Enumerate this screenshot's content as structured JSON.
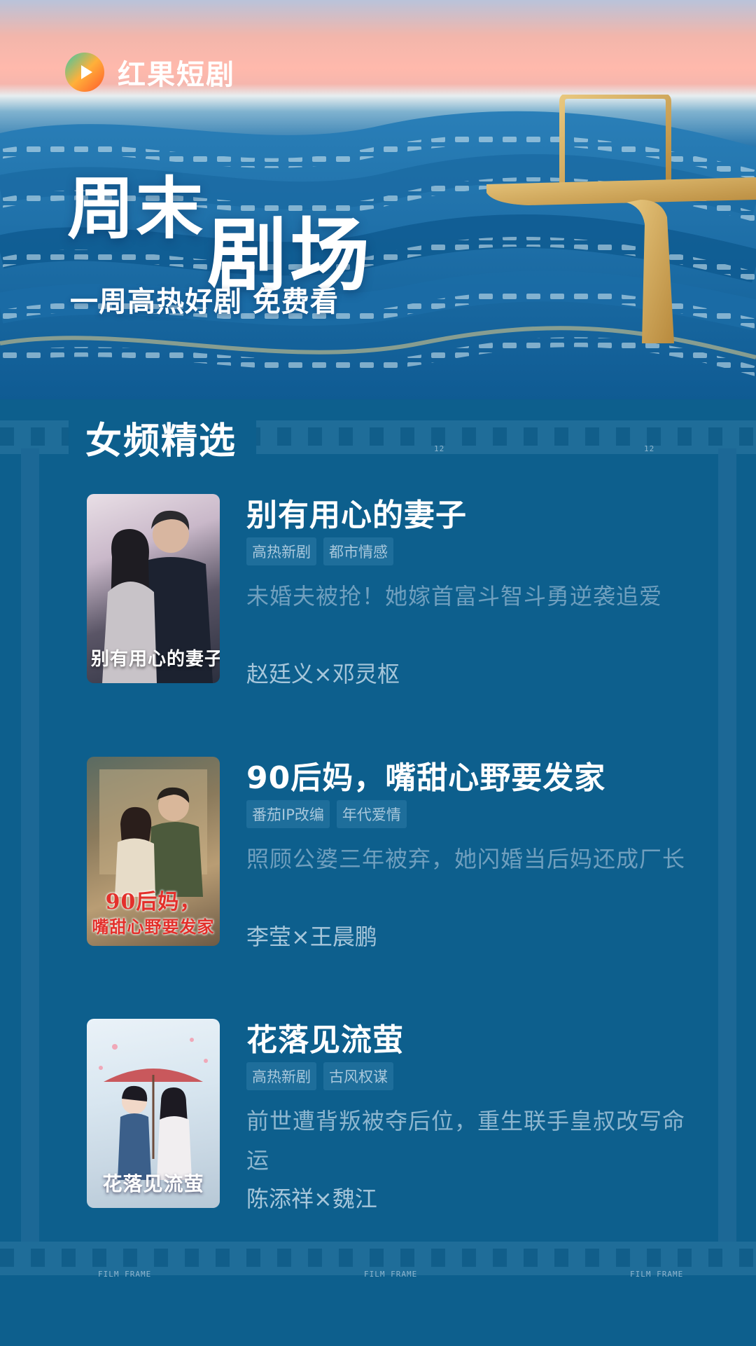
{
  "header": {
    "app_name": "红果短剧",
    "title_part1": "周末",
    "title_part2": "剧场",
    "subtitle": "一周高热好剧 免费看"
  },
  "section": {
    "title": "女频精选"
  },
  "film_labels": {
    "num_12": "12",
    "film_frame": "FILM FRAME"
  },
  "dramas": [
    {
      "title": "别有用心的妻子",
      "tags": [
        "高热新剧",
        "都市情感"
      ],
      "description": "未婚夫被抢！她嫁首富斗智斗勇逆袭追爱",
      "cast": "赵廷义×邓灵枢",
      "poster_text": "别有用心的妻子"
    },
    {
      "title": "90后妈，嘴甜心野要发家",
      "tags": [
        "番茄IP改编",
        "年代爱情"
      ],
      "description": "照顾公婆三年被弃，她闪婚当后妈还成厂长",
      "cast": "李莹×王晨鹏",
      "poster_text_line1": "90后妈，",
      "poster_text_line2": "嘴甜心野要发家"
    },
    {
      "title": "花落见流萤",
      "tags": [
        "高热新剧",
        "古风权谋"
      ],
      "description": "前世遭背叛被夺后位，重生联手皇叔改写命运",
      "cast": "陈添祥×魏江",
      "poster_text": "花落见流萤"
    }
  ],
  "colors": {
    "background": "#0d5f8d",
    "tag_bg": "#1e6e9b",
    "desc_text": "#6f9fbe",
    "logo_orange": "#ff6a2b",
    "logo_green": "#39c8a8"
  }
}
